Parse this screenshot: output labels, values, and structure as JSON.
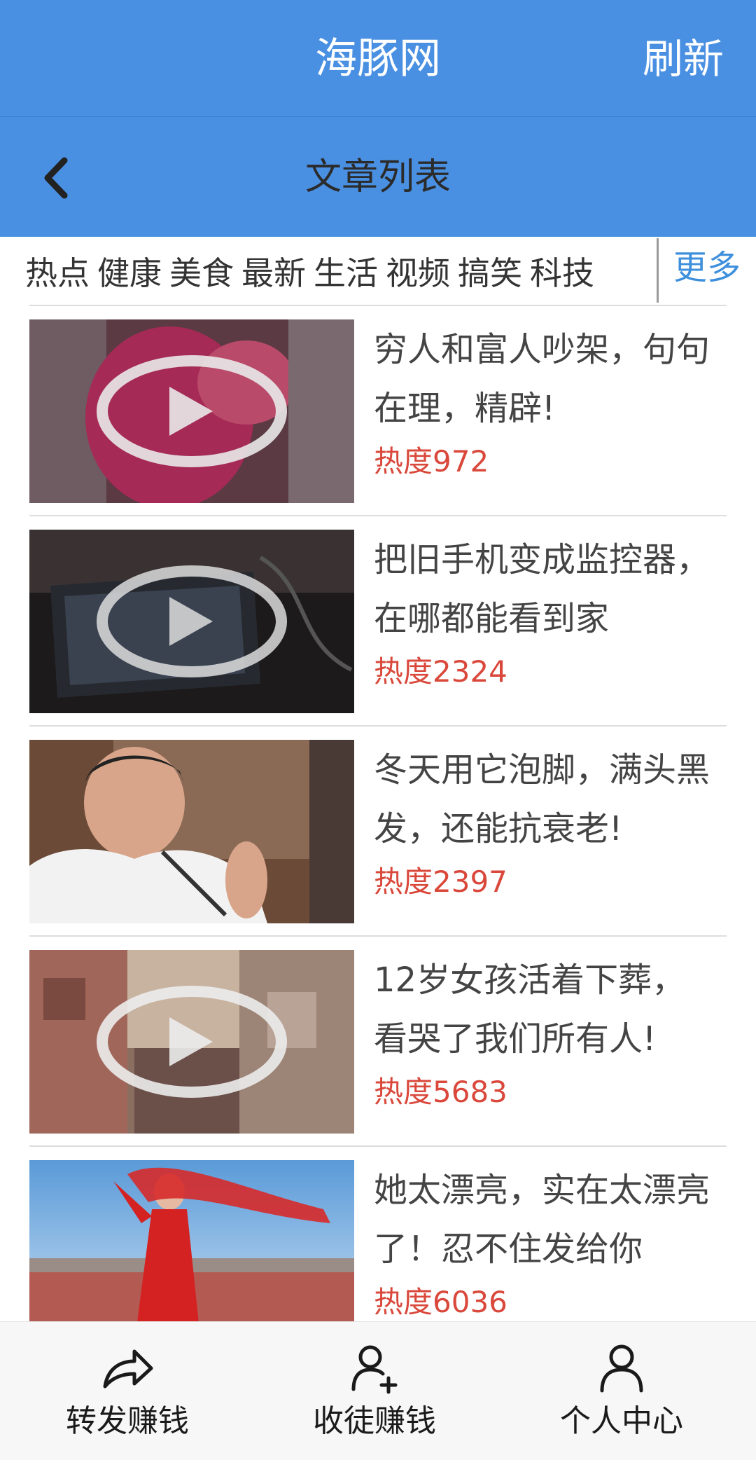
{
  "header": {
    "app_title": "海豚网",
    "refresh_label": "刷新"
  },
  "subheader": {
    "title": "文章列表"
  },
  "categories": {
    "items": [
      "热点",
      "健康",
      "美食",
      "最新",
      "生活",
      "视频",
      "搞笑",
      "科技"
    ],
    "more_label": "更多"
  },
  "articles": [
    {
      "title": "穷人和富人吵架，句句在理，精辟!",
      "heat": "热度972",
      "thumb": "video-blurred-red"
    },
    {
      "title": "把旧手机变成监控器，在哪都能看到家",
      "heat": "热度2324",
      "thumb": "video-dark-phone"
    },
    {
      "title": "冬天用它泡脚，满头黑发，还能抗衰老!",
      "heat": "热度2397",
      "thumb": "photo-man-speaking"
    },
    {
      "title": "12岁女孩活着下葬，看哭了我们所有人!",
      "heat": "热度5683",
      "thumb": "video-pixelated-crowd"
    },
    {
      "title": "她太漂亮，实在太漂亮了！忍不住发给你",
      "heat": "热度6036",
      "thumb": "photo-woman-red-dress"
    }
  ],
  "bottom_nav": [
    {
      "label": "转发赚钱",
      "icon": "share-arrow-icon"
    },
    {
      "label": "收徒赚钱",
      "icon": "add-user-icon"
    },
    {
      "label": "个人中心",
      "icon": "user-icon"
    }
  ],
  "colors": {
    "header_bg": "#4a90e2",
    "accent_blue": "#3e8fdc",
    "heat_red": "#d9483b"
  }
}
